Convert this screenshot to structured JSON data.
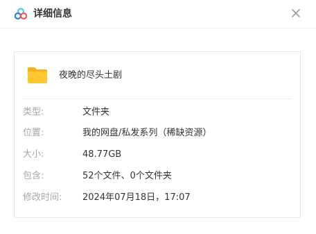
{
  "header": {
    "title": "详细信息",
    "logo_icon": "baidu-netdisk-logo",
    "close_icon": "close-icon"
  },
  "item": {
    "icon": "folder-icon",
    "name": "夜晚的尽头土剧"
  },
  "details": [
    {
      "label": "类型:",
      "value": "文件夹"
    },
    {
      "label": "位置:",
      "value": "我的网盘/私发系列（稀缺资源）"
    },
    {
      "label": "大小:",
      "value": "48.77GB"
    },
    {
      "label": "包含:",
      "value": "52个文件、0个文件夹"
    },
    {
      "label": "修改时间:",
      "value": "2024年07月18日，17:07"
    }
  ],
  "colors": {
    "title_text": "#333333",
    "label_text": "#a6a6a6",
    "value_text": "#333333",
    "folder_yellow": "#ffc634",
    "logo_blue": "#2a82e4",
    "logo_cyan": "#56c6f0",
    "logo_red": "#f45a4f"
  }
}
